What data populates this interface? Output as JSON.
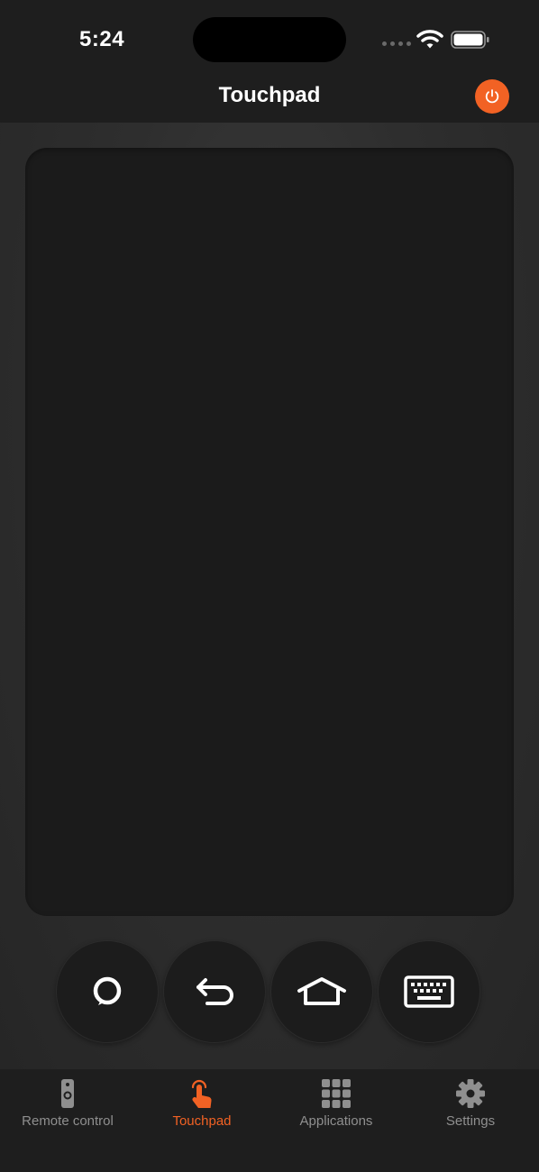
{
  "status_bar": {
    "time": "5:24"
  },
  "nav": {
    "title": "Touchpad",
    "power_icon": "power-icon"
  },
  "touchpad": {
    "surface": "touchpad-area"
  },
  "controls": [
    {
      "name": "alexa-button",
      "icon": "alexa-ring-icon"
    },
    {
      "name": "back-button",
      "icon": "back-arrow-icon"
    },
    {
      "name": "home-button",
      "icon": "home-icon"
    },
    {
      "name": "keyboard-button",
      "icon": "keyboard-icon"
    }
  ],
  "tabs": [
    {
      "label": "Remote control",
      "icon": "remote-icon",
      "active": false
    },
    {
      "label": "Touchpad",
      "icon": "touch-hand-icon",
      "active": true
    },
    {
      "label": "Applications",
      "icon": "grid-icon",
      "active": false
    },
    {
      "label": "Settings",
      "icon": "gear-icon",
      "active": false
    }
  ],
  "colors": {
    "accent": "#f26224",
    "background": "#1c1c1c",
    "inactive_tab": "#8f8f8f"
  }
}
